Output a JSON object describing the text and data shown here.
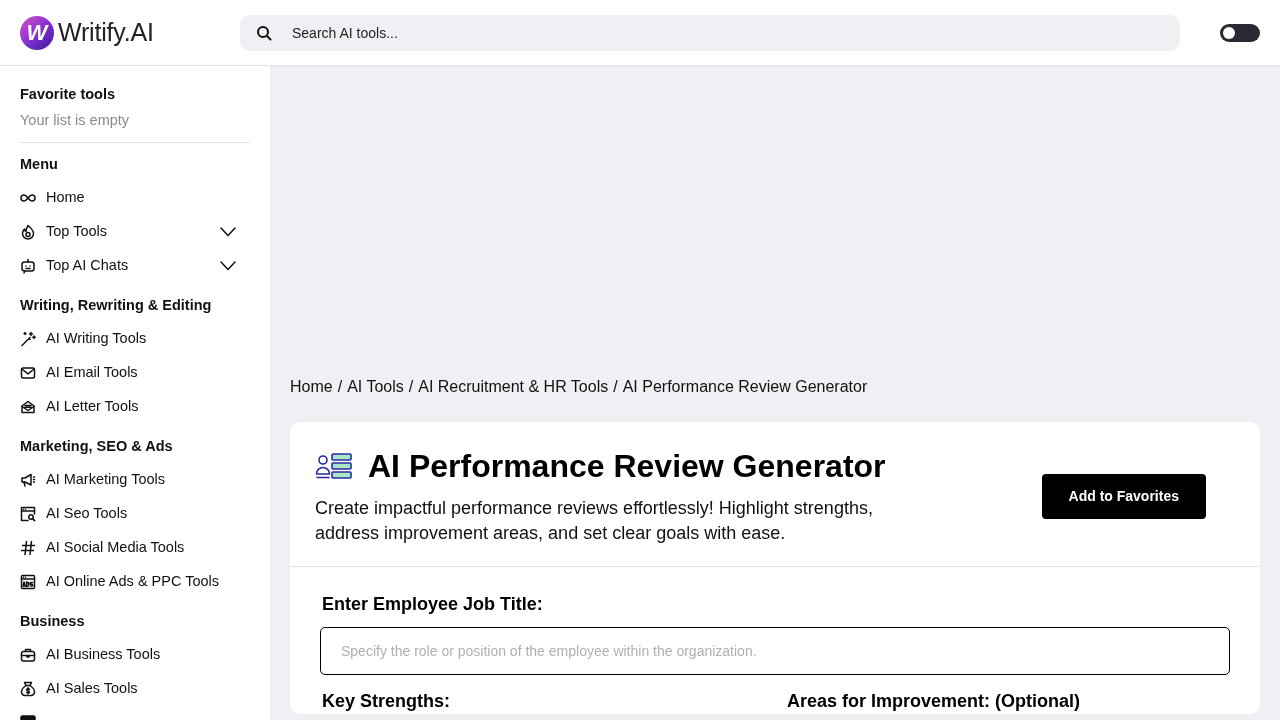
{
  "header": {
    "logo": {
      "mark": "W",
      "text": "Writify.AI"
    },
    "search": {
      "placeholder": "Search AI tools..."
    },
    "theme_toggle": {
      "on": false
    }
  },
  "sidebar": {
    "favorites": {
      "title": "Favorite tools",
      "empty_text": "Your list is empty"
    },
    "sections": [
      {
        "title": "Menu",
        "items": [
          {
            "label": "Home",
            "kind": "link"
          },
          {
            "label": "Top Tools",
            "kind": "dropdown",
            "expanded": false
          },
          {
            "label": "Top AI Chats",
            "kind": "dropdown",
            "expanded": false
          }
        ]
      },
      {
        "title": "Writing, Rewriting & Editing",
        "items": [
          {
            "label": "AI Writing Tools",
            "kind": "link"
          },
          {
            "label": "AI Email Tools",
            "kind": "link"
          },
          {
            "label": "AI Letter Tools",
            "kind": "link"
          }
        ]
      },
      {
        "title": "Marketing, SEO & Ads",
        "items": [
          {
            "label": "AI Marketing Tools",
            "kind": "link"
          },
          {
            "label": "AI Seo Tools",
            "kind": "link"
          },
          {
            "label": "AI Social Media Tools",
            "kind": "link"
          },
          {
            "label": "AI Online Ads & PPC Tools",
            "kind": "link"
          }
        ]
      },
      {
        "title": "Business",
        "items": [
          {
            "label": "AI Business Tools",
            "kind": "link"
          },
          {
            "label": "AI Sales Tools",
            "kind": "link"
          },
          {
            "kind": "link"
          }
        ]
      }
    ]
  },
  "breadcrumb": {
    "separator": "/",
    "items": [
      "Home",
      "AI Tools",
      "AI Recruitment & HR Tools",
      "AI Performance Review Generator"
    ]
  },
  "tool": {
    "title": "AI Performance Review Generator",
    "description": "Create impactful performance reviews effortlessly! Highlight strengths, address improvement areas, and set clear goals with ease.",
    "favorite_button": "Add to Favorites"
  },
  "form": {
    "rows": [
      {
        "fields": [
          {
            "label": "Enter Employee Job Title:",
            "placeholder": "Specify the role or position of the employee within the organization."
          }
        ]
      },
      {
        "fields": [
          {
            "label": "Key Strengths:"
          },
          {
            "label": "Areas for Improvement: (Optional)"
          }
        ]
      }
    ]
  }
}
